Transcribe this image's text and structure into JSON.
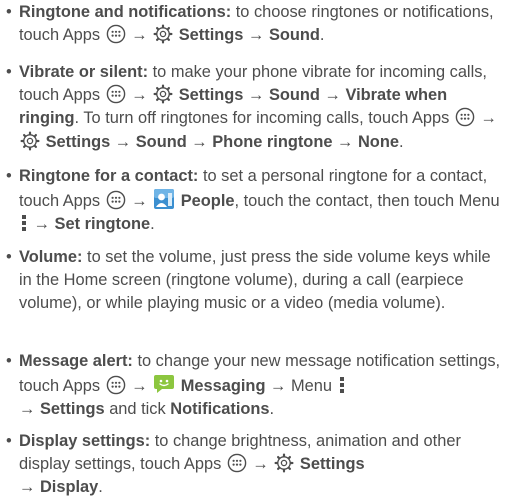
{
  "arrow": "→",
  "items": [
    {
      "bold": "Ringtone and notifications:",
      "text1": "to choose ringtones or notifications, touch Apps",
      "settings": "Settings",
      "sound": "Sound",
      "period": "."
    },
    {
      "bold": "Vibrate or silent:",
      "text1": "to make your phone vibrate for incoming calls, touch Apps",
      "settings": "Settings",
      "sound": "Sound",
      "vibrate": "Vibrate when ringing",
      "text2": ". To turn off ringtones for incoming calls, touch Apps",
      "settings2": "Settings",
      "sound2": "Sound",
      "phone_ringtone": "Phone ringtone",
      "none": "None",
      "period": "."
    },
    {
      "bold": "Ringtone for a contact:",
      "text1": "to set a personal ringtone for a contact, touch Apps",
      "people": "People",
      "text2": ", touch the contact, then touch Menu",
      "set_ringtone": "Set ringtone",
      "period": "."
    },
    {
      "bold": "Volume:",
      "text1": "to set the volume, just press the side volume keys while in the Home screen (ringtone volume), during a call (earpiece volume), or while playing music or a video (media volume)."
    },
    {
      "bold": "Message alert:",
      "text1": "to change your new message notification settings, touch Apps",
      "messaging": "Messaging",
      "menu_text": "Menu",
      "settings": "Settings",
      "text2": "and tick",
      "notifications": "Notifications",
      "period": "."
    },
    {
      "bold": "Display settings:",
      "text1": "to change brightness, animation and other display settings, touch Apps",
      "settings": "Settings",
      "display": "Display",
      "period": "."
    }
  ],
  "icons": {
    "apps": "apps-icon",
    "settings": "settings-gear-icon",
    "people": "people-app-icon",
    "menu": "menu-dots-icon",
    "messaging": "messaging-app-icon"
  },
  "colors": {
    "text": "#4d4d4d",
    "people_blue": "#3b8fd0",
    "messaging_green": "#8cc63f"
  }
}
